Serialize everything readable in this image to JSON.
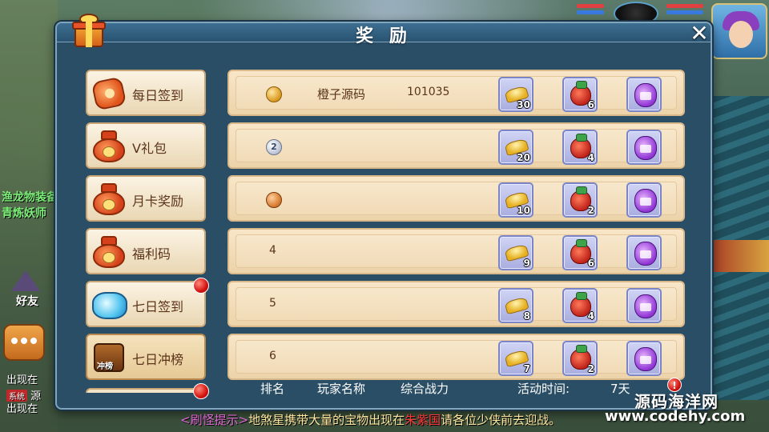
{
  "dialog": {
    "title": "奖 励",
    "close_label": "✕"
  },
  "scene": {
    "left_labels": [
      "渔龙物装备",
      "青炼妖师"
    ],
    "friend_label": "好友",
    "chat_lines": [
      {
        "text": "出现在",
        "tag": ""
      },
      {
        "text": "源",
        "tag": "系统"
      },
      {
        "text": "出现在",
        "tag": ""
      }
    ]
  },
  "menu": [
    {
      "label": "每日签到",
      "icon": "coin-icon",
      "red_dot": false
    },
    {
      "label": "V礼包",
      "icon": "lucky-bag-icon",
      "red_dot": false
    },
    {
      "label": "月卡奖励",
      "icon": "lucky-bag-icon",
      "red_dot": false
    },
    {
      "label": "福利码",
      "icon": "lucky-bag-icon",
      "red_dot": false
    },
    {
      "label": "七日签到",
      "icon": "crystal-bag-icon",
      "red_dot": true
    },
    {
      "label": "七日冲榜",
      "icon": "chest-icon",
      "red_dot": false,
      "icon_text": "冲榜"
    }
  ],
  "ranking_rows": [
    {
      "rank": "1",
      "medal": "gold",
      "player": "橙子源码",
      "power": "101035",
      "items": [
        "30",
        "6",
        ""
      ]
    },
    {
      "rank": "2",
      "medal": "silver",
      "player": "",
      "power": "",
      "items": [
        "20",
        "4",
        ""
      ]
    },
    {
      "rank": "3",
      "medal": "bronze",
      "player": "",
      "power": "",
      "items": [
        "10",
        "2",
        ""
      ]
    },
    {
      "rank": "4",
      "medal": "",
      "player": "",
      "power": "",
      "items": [
        "9",
        "6",
        ""
      ]
    },
    {
      "rank": "5",
      "medal": "",
      "player": "",
      "power": "",
      "items": [
        "8",
        "4",
        ""
      ]
    },
    {
      "rank": "6",
      "medal": "",
      "player": "",
      "power": "",
      "items": [
        "7",
        "2",
        ""
      ]
    }
  ],
  "reward_item_icons": [
    "gold-ingot-icon",
    "red-bag-icon",
    "purple-bag-icon"
  ],
  "footer": {
    "rank_header": "排名",
    "player_header": "玩家名称",
    "power_header": "综合战力",
    "time_label": "活动时间:",
    "time_value": "7天",
    "warn_label": "!"
  },
  "notice": {
    "tag": "<刷怪提示>",
    "text1": "地煞星携带大量的宝物出现在",
    "place": "朱紫国",
    "text2": "请各位少侠前去迎战。"
  },
  "watermark": {
    "line1": "源码海洋网",
    "line2": "www.codehy.com"
  }
}
